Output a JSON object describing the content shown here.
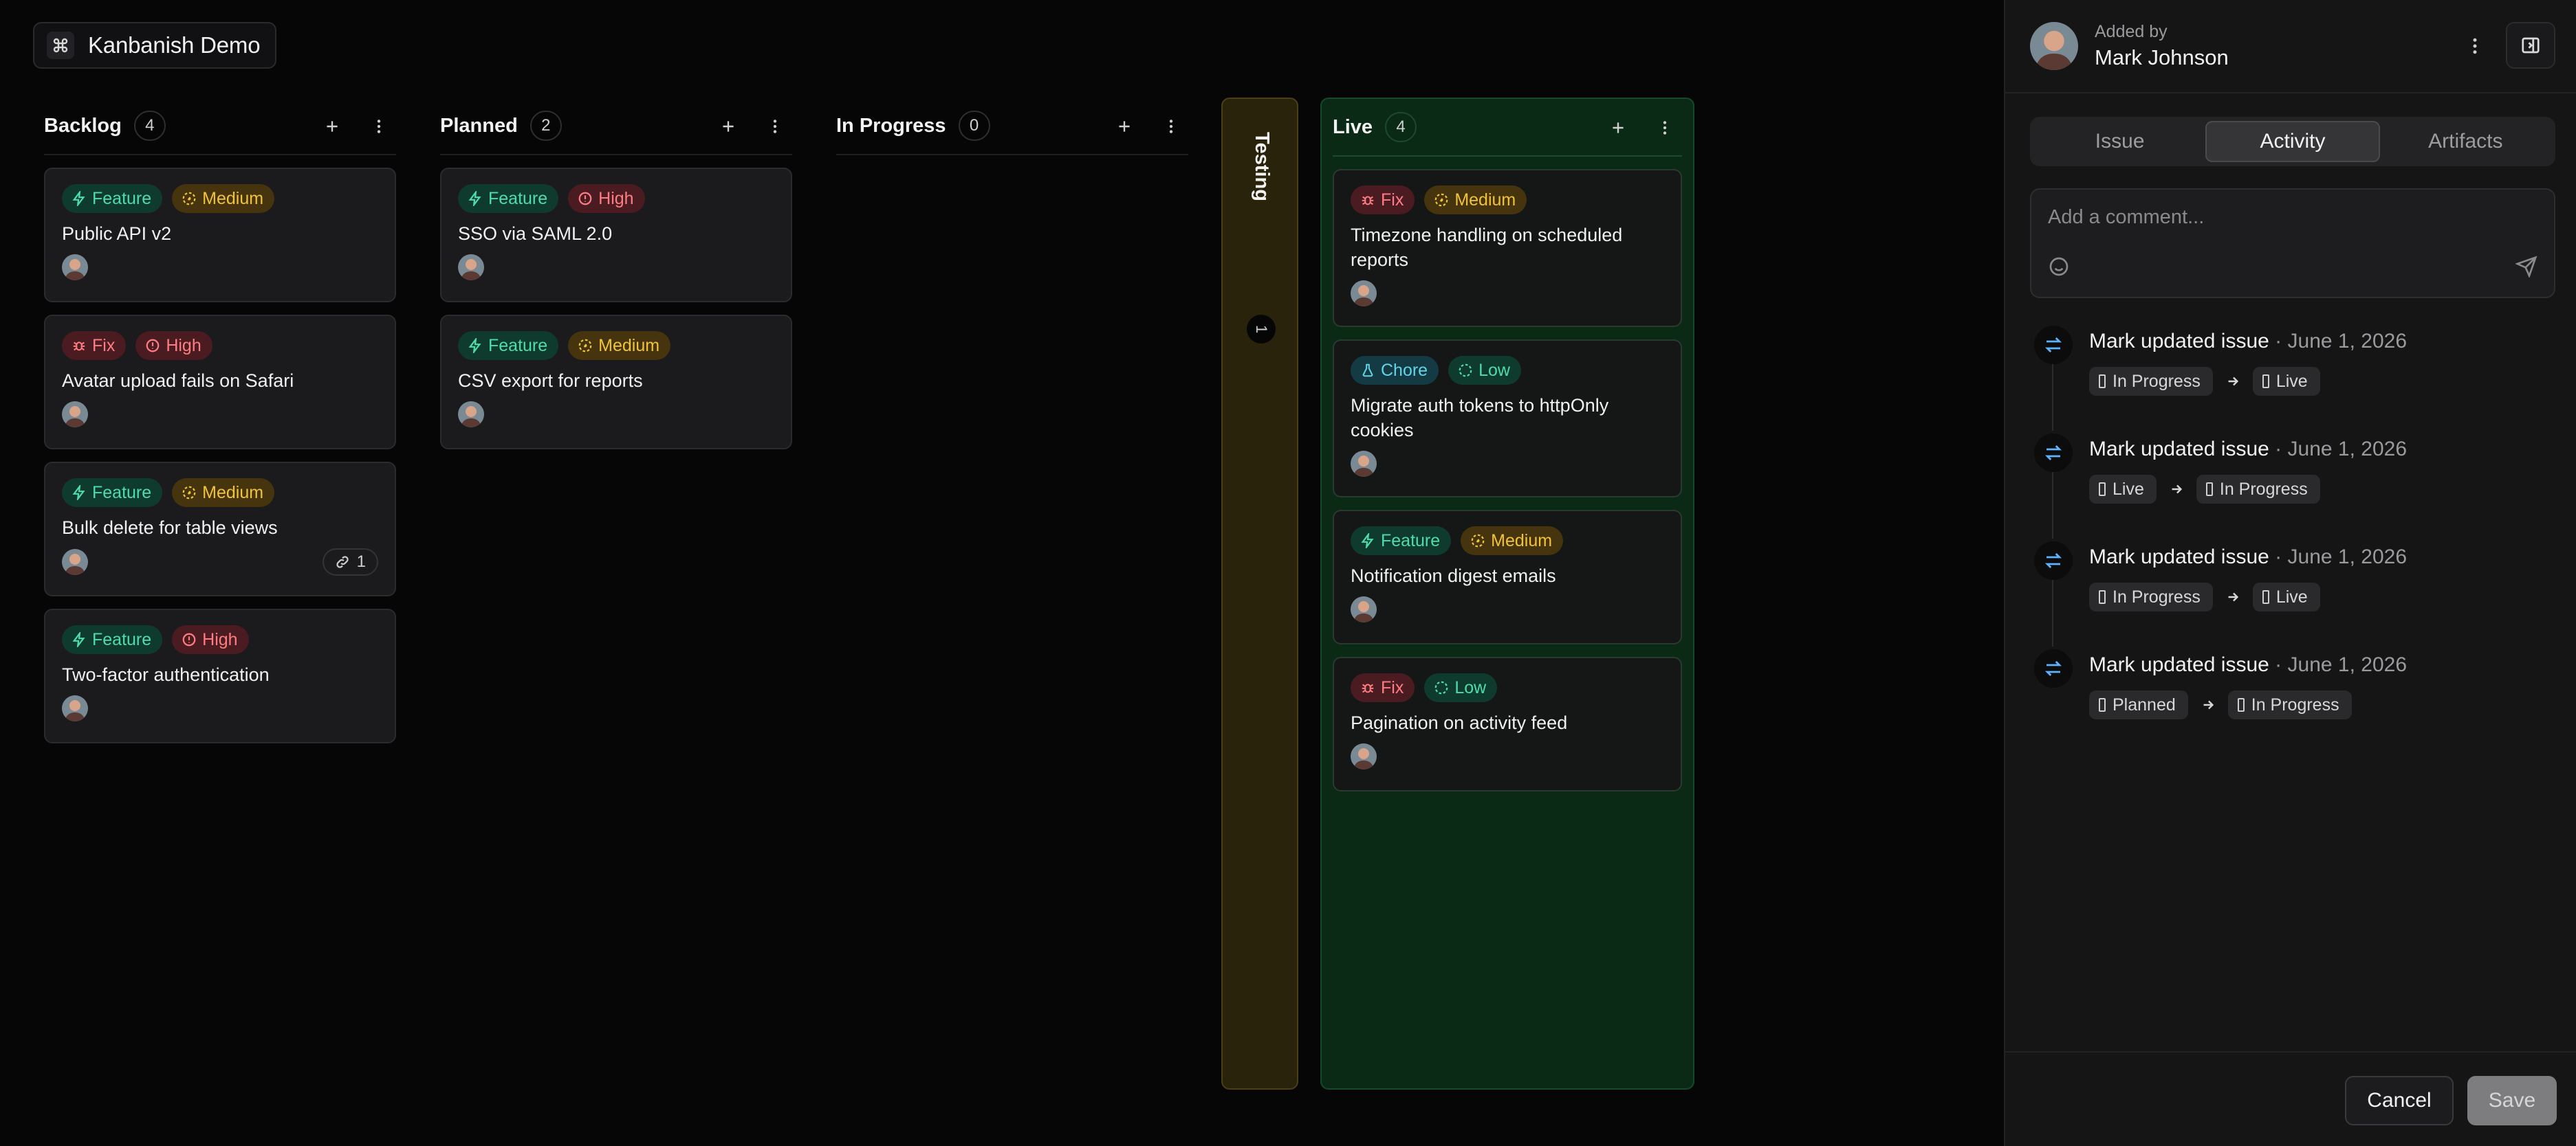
{
  "workspace": {
    "title": "Kanbanish Demo",
    "icon": "command-icon"
  },
  "columns": [
    {
      "id": "backlog",
      "title": "Backlog",
      "count": "4",
      "cards": [
        {
          "type": "Feature",
          "priority": "Medium",
          "title": "Public API v2"
        },
        {
          "type": "Fix",
          "priority": "High",
          "title": "Avatar upload fails on Safari"
        },
        {
          "type": "Feature",
          "priority": "Medium",
          "title": "Bulk delete for table views",
          "links": "1"
        },
        {
          "type": "Feature",
          "priority": "High",
          "title": "Two-factor authentication"
        }
      ]
    },
    {
      "id": "planned",
      "title": "Planned",
      "count": "2",
      "cards": [
        {
          "type": "Feature",
          "priority": "High",
          "title": "SSO via SAML 2.0"
        },
        {
          "type": "Feature",
          "priority": "Medium",
          "title": "CSV export for reports"
        }
      ]
    },
    {
      "id": "in-progress",
      "title": "In Progress",
      "count": "0",
      "cards": []
    },
    {
      "id": "testing",
      "title": "Testing",
      "count": "1",
      "collapsed": true,
      "color": "#2a230b"
    },
    {
      "id": "live",
      "title": "Live",
      "count": "4",
      "color": "#0a2a16",
      "cards": [
        {
          "type": "Fix",
          "priority": "Medium",
          "title": "Timezone handling on scheduled reports"
        },
        {
          "type": "Chore",
          "priority": "Low",
          "title": "Migrate auth tokens to httpOnly cookies"
        },
        {
          "type": "Feature",
          "priority": "Medium",
          "title": "Notification digest emails"
        },
        {
          "type": "Fix",
          "priority": "Low",
          "title": "Pagination on activity feed"
        }
      ]
    }
  ],
  "panel": {
    "added_by_label": "Added by",
    "author": "Mark Johnson",
    "tabs": [
      {
        "label": "Issue",
        "active": false
      },
      {
        "label": "Activity",
        "active": true
      },
      {
        "label": "Artifacts",
        "active": false
      }
    ],
    "comment": {
      "placeholder": "Add a comment...",
      "value": ""
    },
    "activity": [
      {
        "who": "Mark",
        "action": "updated issue",
        "when": "June 1, 2026",
        "from": "In Progress",
        "to": "Live"
      },
      {
        "who": "Mark",
        "action": "updated issue",
        "when": "June 1, 2026",
        "from": "Live",
        "to": "In Progress"
      },
      {
        "who": "Mark",
        "action": "updated issue",
        "when": "June 1, 2026",
        "from": "In Progress",
        "to": "Live"
      },
      {
        "who": "Mark",
        "action": "updated issue",
        "when": "June 1, 2026",
        "from": "Planned",
        "to": "In Progress"
      }
    ],
    "cancel_label": "Cancel",
    "save_label": "Save"
  },
  "colors": {
    "feature": "#4fdcaa",
    "fix": "#ff7d82",
    "chore": "#63d3e8",
    "medium": "#f1c23b",
    "high": "#ff7d82",
    "low": "#4fdcaa",
    "activity_icon": "#5cb4ff"
  }
}
